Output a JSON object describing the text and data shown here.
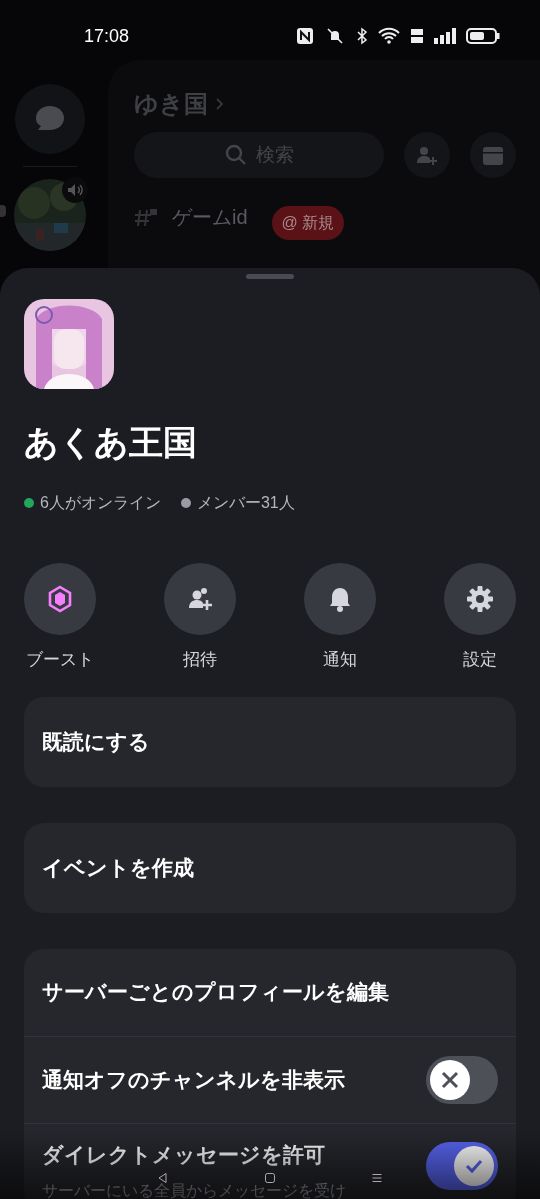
{
  "status_bar": {
    "time": "17:08"
  },
  "background": {
    "server_name": "ゆき国",
    "search_placeholder": "検索",
    "channel": {
      "name": "ゲームid",
      "badge": "@ 新規"
    }
  },
  "sheet": {
    "server_name": "あくあ王国",
    "stats": [
      {
        "text": "6人がオンライン",
        "color": "#23a55a"
      },
      {
        "text": "メンバー31人",
        "color": "#9b9ca3"
      }
    ],
    "actions": [
      {
        "label": "ブースト",
        "kind": "boost"
      },
      {
        "label": "招待",
        "kind": "invite"
      },
      {
        "label": "通知",
        "kind": "notifications"
      },
      {
        "label": "設定",
        "kind": "settings"
      }
    ],
    "cards": [
      {
        "label": "既読にする"
      },
      {
        "label": "イベントを作成"
      }
    ],
    "settings": [
      {
        "label": "サーバーごとのプロフィールを編集",
        "kind": "link"
      },
      {
        "label": "通知オフのチャンネルを非表示",
        "kind": "toggle",
        "on": false
      },
      {
        "label": "ダイレクトメッセージを許可",
        "description": "サーバーにいる全員からメッセージを受け",
        "kind": "toggle",
        "on": true
      }
    ]
  }
}
